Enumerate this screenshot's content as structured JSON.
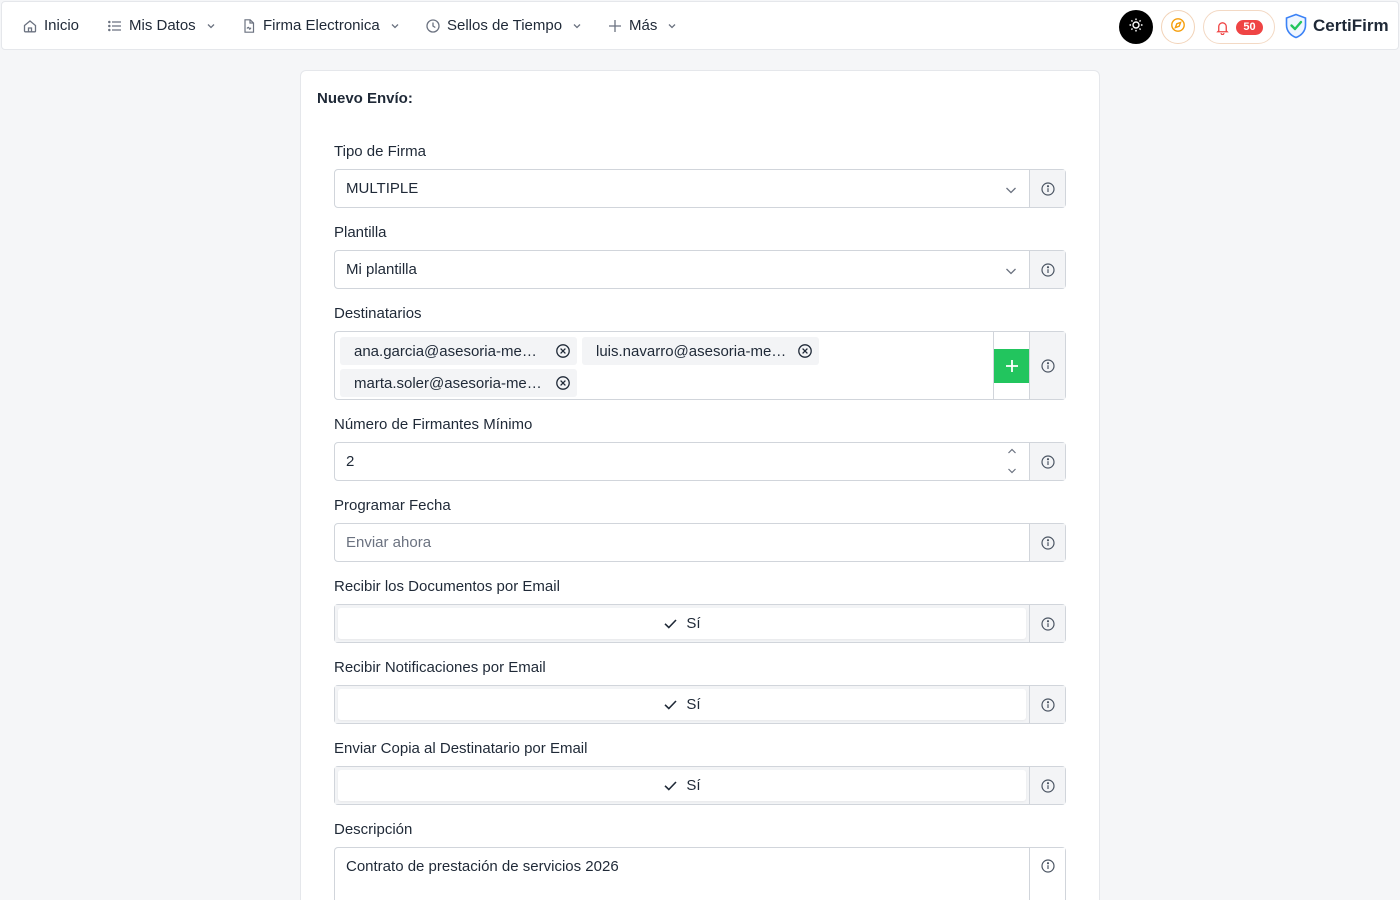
{
  "nav": {
    "items": [
      {
        "label": "Inicio",
        "icon": "home-icon",
        "dropdown": false
      },
      {
        "label": "Mis Datos",
        "icon": "list-icon",
        "dropdown": true
      },
      {
        "label": "Firma Electronica",
        "icon": "document-icon",
        "dropdown": true
      },
      {
        "label": "Sellos de Tiempo",
        "icon": "clock-icon",
        "dropdown": true
      },
      {
        "label": "Más",
        "icon": "plus-icon",
        "dropdown": true
      }
    ],
    "notifications_count": "50",
    "brand_name": "CertiFirm"
  },
  "colors": {
    "accent_green": "#22c55e",
    "badge_red": "#ef4444",
    "compass_orange": "#f59e0b",
    "brand_check_green": "#22c55e",
    "brand_shield_blue": "#3b82f6"
  },
  "form": {
    "title": "Nuevo Envío:",
    "tipo_firma": {
      "label": "Tipo de Firma",
      "value": "MULTIPLE"
    },
    "plantilla": {
      "label": "Plantilla",
      "value": "Mi plantilla"
    },
    "destinatarios": {
      "label": "Destinatarios",
      "chips": [
        "ana.garcia@asesoria-mendez.es",
        "luis.navarro@asesoria-mendez.es",
        "marta.soler@asesoria-mendez.es"
      ]
    },
    "firmantes_minimo": {
      "label": "Número de Firmantes Mínimo",
      "value": "2"
    },
    "programar_fecha": {
      "label": "Programar Fecha",
      "placeholder": "Enviar ahora"
    },
    "recibir_documentos": {
      "label": "Recibir los Documentos por Email",
      "value": "Sí"
    },
    "recibir_notificaciones": {
      "label": "Recibir Notificaciones por Email",
      "value": "Sí"
    },
    "enviar_copia": {
      "label": "Enviar Copia al Destinatario por Email",
      "value": "Sí"
    },
    "descripcion": {
      "label": "Descripción",
      "value": "Contrato de prestación de servicios 2026"
    }
  }
}
